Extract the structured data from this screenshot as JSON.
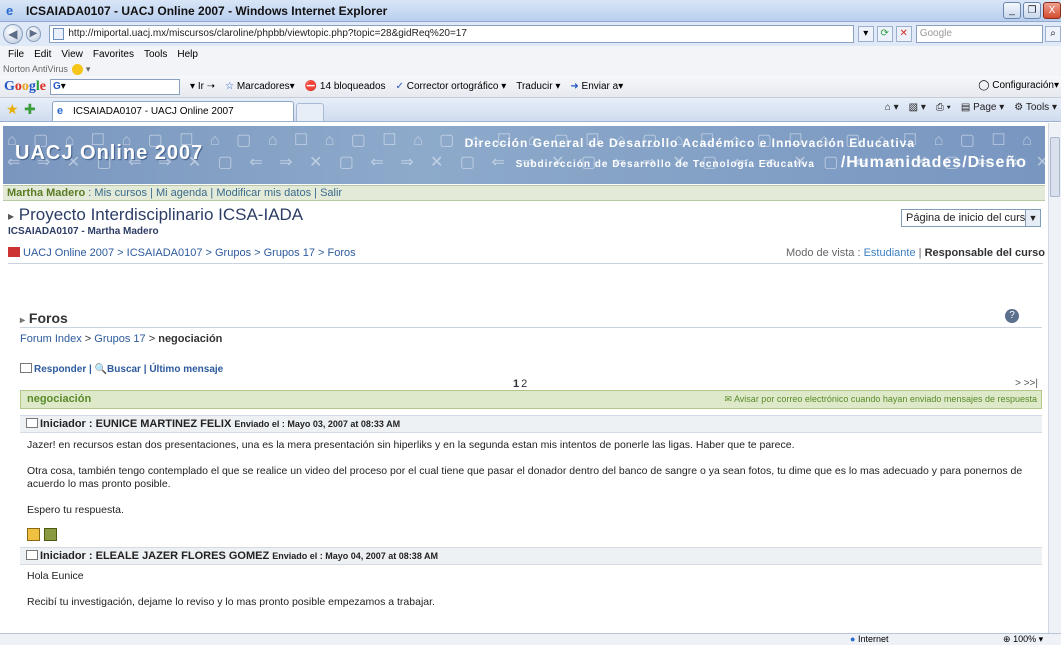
{
  "window": {
    "title": "ICSAIADA0107 - UACJ Online 2007 - Windows Internet Explorer",
    "minimize": "_",
    "maximize": "❐",
    "close": "X"
  },
  "address": {
    "url": "http://miportal.uacj.mx/miscursos/claroline/phpbb/viewtopic.php?topic=28&gidReq%20=17",
    "search_placeholder": "Google"
  },
  "menu": [
    "File",
    "Edit",
    "View",
    "Favorites",
    "Tools",
    "Help"
  ],
  "norton": "Norton AntiVirus",
  "google_toolbar": {
    "go": "Ir",
    "bookmarks": "Marcadores",
    "blocked": "14 bloqueados",
    "spell": "Corrector ortográfico",
    "translate": "Traducir",
    "send": "Enviar a",
    "config": "Configuración"
  },
  "tab": {
    "label": "ICSAIADA0107 - UACJ Online 2007"
  },
  "commands": {
    "page": "Page",
    "tools": "Tools"
  },
  "banner": {
    "title": "UACJ Online 2007",
    "line1": "Dirección General de Desarrollo Académico e Innovación Educativa",
    "line2": "Subdirección de Desarrollo de Tecnología Educativa",
    "humanidades": "/Humanidades/Diseño"
  },
  "userbar": {
    "name": "Martha Madero",
    "sep0": " : ",
    "my_courses": "Mis cursos",
    "sep1": " | ",
    "agenda": "Mi agenda",
    "sep2": " | ",
    "modify": "Modificar mis datos",
    "sep3": " | ",
    "logout": "Salir"
  },
  "course": {
    "title": "Proyecto Interdisciplinario ICSA-IADA",
    "subtitle": "ICSAIADA0107 - Martha Madero",
    "home_select": "Página de inicio del curso"
  },
  "breadcrumb": {
    "text": "UACJ Online 2007 > ICSAIADA0107 > Grupos > Grupos 17 > Foros"
  },
  "viewmode": {
    "label": "Modo de vista : ",
    "student": "Estudiante",
    "sep": " | ",
    "responsible": "Responsable del curso"
  },
  "foros": {
    "title": "Foros",
    "help": "?"
  },
  "forum_bc": {
    "index": "Forum Index",
    "sep1": " > ",
    "group": "Grupos 17",
    "sep2": " > ",
    "topic": "negociación"
  },
  "actions": {
    "reply": "Responder",
    "sep1": " | ",
    "search": "Buscar",
    "sep2": " | ",
    "last": "Último mensaje"
  },
  "pagination": {
    "current": "1",
    "other": "2",
    "next": ">  >>|"
  },
  "thread": {
    "title": "negociación",
    "notify": "Avisar por correo electrónico cuando hayan enviado mensajes de respuesta"
  },
  "posts": [
    {
      "label": "Iniciador : EUNICE MARTINEZ FELIX",
      "sent": "Enviado el : Mayo 03, 2007 at 08:33 AM",
      "p1": "Jazer! en recursos estan dos presentaciones, una es la mera presentación sin hiperliks y en la segunda estan mis intentos de ponerle las ligas. Haber que te parece.",
      "p2": "Otra cosa, también tengo contemplado el que se realice un  video del proceso por el cual tiene que pasar el donador dentro del banco de sangre o ya sean fotos, tu dime que es lo mas adecuado y para ponernos de acuerdo lo mas pronto posible.",
      "p3": "Espero tu respuesta."
    },
    {
      "label": "Iniciador : ELEALE JAZER FLORES GOMEZ",
      "sent": "Enviado el : Mayo 04, 2007 at 08:38 AM",
      "p1": "Hola Eunice",
      "p2": "Recibí tu investigación, dejame lo reviso y lo mas pronto posible empezamos a trabajar."
    }
  ],
  "status": {
    "zone": "Internet",
    "zoom": "100%"
  }
}
